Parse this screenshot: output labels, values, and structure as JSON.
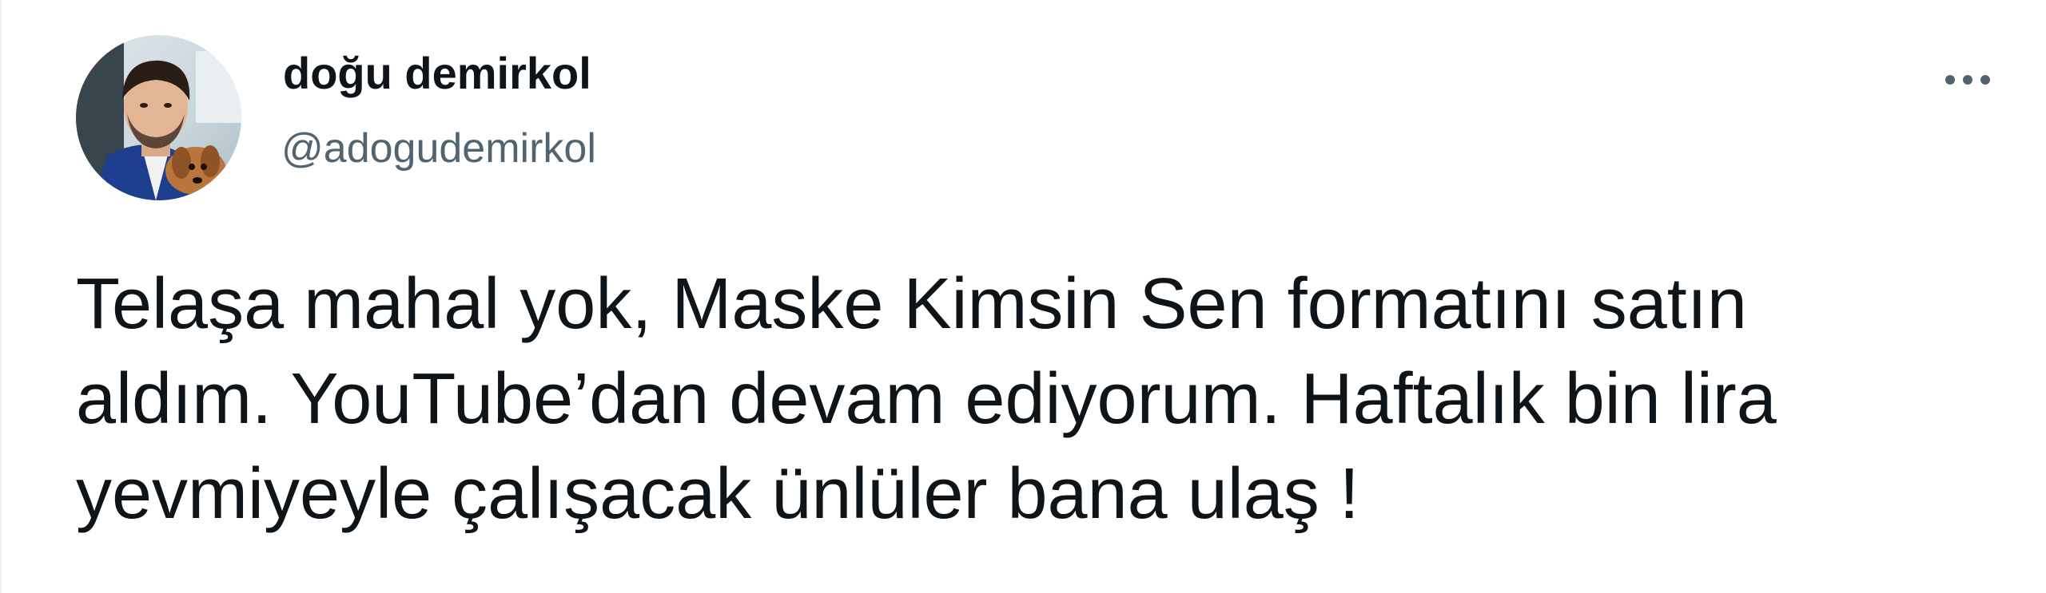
{
  "tweet": {
    "author": {
      "display_name": "doğu demirkol",
      "handle": "@adogudemirkol",
      "avatar_icon": "profile-photo"
    },
    "more_icon": "more-horizontal-icon",
    "text": "Telaşa mahal yok, Maske Kimsin Sen formatını satın\naldım. YouTube’dan devam ediyorum. Haftalık bin lira\nyevmiyeyle çalışacak ünlüler bana ulaş !"
  },
  "colors": {
    "text_primary": "#0f1419",
    "text_secondary": "#536471",
    "border": "#eff3f4"
  }
}
